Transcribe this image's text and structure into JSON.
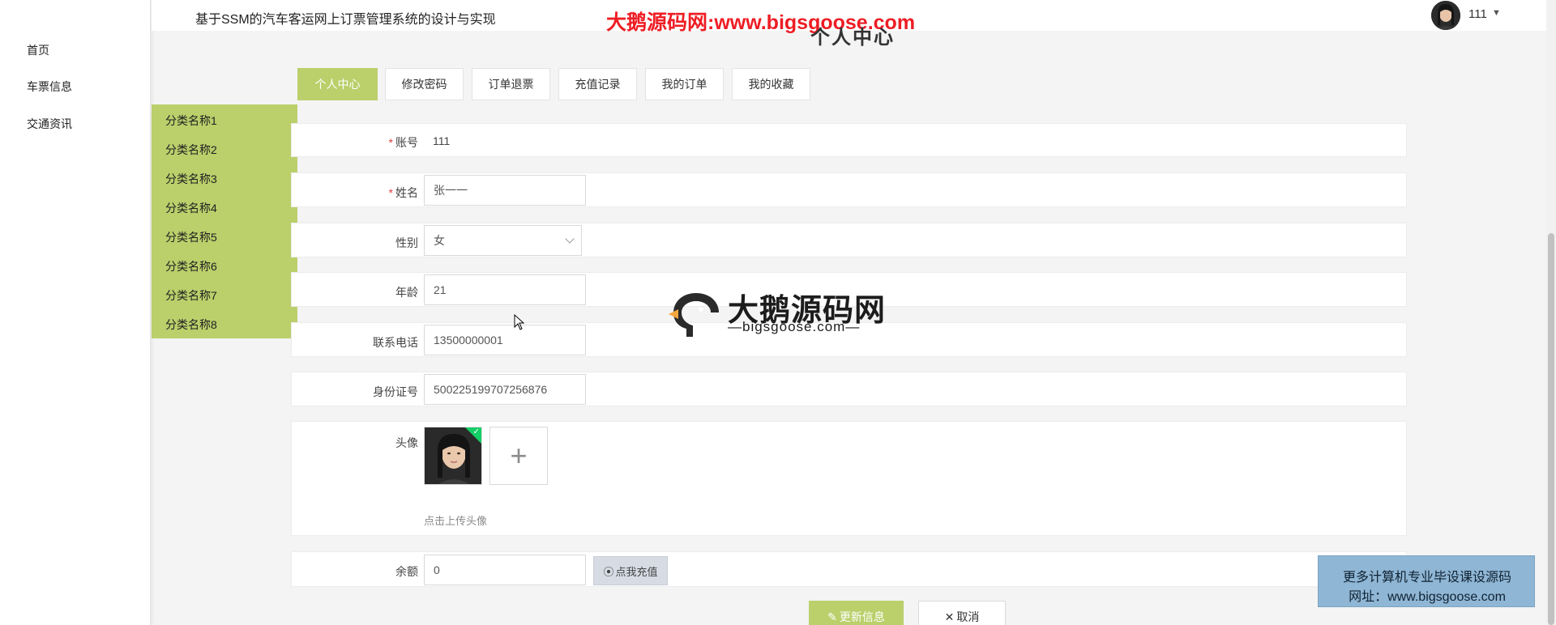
{
  "header": {
    "system_title": "基于SSM的汽车客运网上订票管理系统的设计与实现",
    "watermark_top": "大鹅源码网:www.bigsgoose.com",
    "page_heading": "个人中心",
    "user": {
      "name": "111",
      "avatar_icon": "user-avatar"
    }
  },
  "sidebar": {
    "items": [
      {
        "label": "首页"
      },
      {
        "label": "车票信息"
      },
      {
        "label": "交通资讯"
      }
    ]
  },
  "category_menu": {
    "items": [
      {
        "label": "分类名称1"
      },
      {
        "label": "分类名称2"
      },
      {
        "label": "分类名称3"
      },
      {
        "label": "分类名称4"
      },
      {
        "label": "分类名称5"
      },
      {
        "label": "分类名称6"
      },
      {
        "label": "分类名称7"
      },
      {
        "label": "分类名称8"
      }
    ]
  },
  "tabs": [
    {
      "label": "个人中心",
      "active": true
    },
    {
      "label": "修改密码",
      "active": false
    },
    {
      "label": "订单退票",
      "active": false
    },
    {
      "label": "充值记录",
      "active": false
    },
    {
      "label": "我的订单",
      "active": false
    },
    {
      "label": "我的收藏",
      "active": false
    }
  ],
  "form": {
    "account": {
      "label": "账号",
      "value": "111"
    },
    "name": {
      "label": "姓名",
      "value": "张一一"
    },
    "gender": {
      "label": "性别",
      "value": "女"
    },
    "age": {
      "label": "年龄",
      "value": "21"
    },
    "phone": {
      "label": "联系电话",
      "value": "13500000001"
    },
    "id_card": {
      "label": "身份证号",
      "value": "500225199707256876"
    },
    "avatar": {
      "label": "头像",
      "upload_tip": "点击上传头像",
      "plus": "+"
    },
    "balance": {
      "label": "余额",
      "value": "0",
      "recharge_label": "点我充值"
    },
    "required_mark": "*"
  },
  "actions": {
    "update_label": "更新信息",
    "cancel_label": "取消"
  },
  "watermark": {
    "cn": "大鹅源码网",
    "en": "—bigsgoose.com—"
  },
  "ad": {
    "line1": "更多计算机专业毕设课设源码",
    "line2": "网址：www.bigsgoose.com"
  },
  "colors": {
    "accent": "#bbcf6b",
    "watermark_red": "#ee1d24",
    "required": "#e43d3d",
    "ad_bg": "#8fb6d4"
  }
}
